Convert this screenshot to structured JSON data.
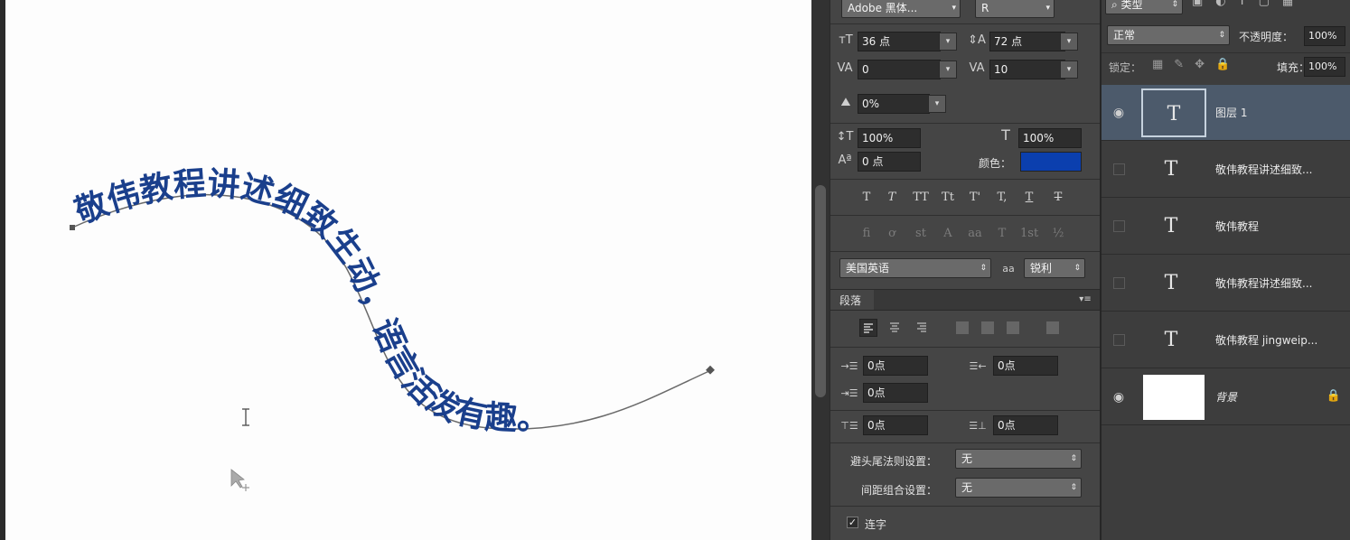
{
  "canvas": {
    "path_text": "敬伟教程讲述细致生动，语言活泼有趣。",
    "text_color": "#1a3f8c"
  },
  "character_panel": {
    "font_family": "Adobe 黑体...",
    "font_style": "R",
    "font_size": "36 点",
    "leading": "72 点",
    "kerning": "0",
    "tracking": "10",
    "tsume": "0%",
    "vertical_scale": "100%",
    "horizontal_scale": "100%",
    "baseline_shift": "0 点",
    "color_label": "颜色：",
    "color_value": "#0b3fae",
    "language": "美国英语",
    "aa_icon": "aa",
    "antialias": "锐利",
    "style_buttons": [
      "T",
      "T",
      "TT",
      "Tt",
      "T'",
      "T,",
      "T",
      "T"
    ],
    "opentype_buttons": [
      "fi",
      "ơ",
      "st",
      "A",
      "aa",
      "T",
      "1st",
      "½"
    ]
  },
  "paragraph_panel": {
    "title": "段落",
    "indent_left": "0点",
    "indent_right": "0点",
    "indent_first": "0点",
    "space_before": "0点",
    "space_after": "0点",
    "kinsoku_label": "避头尾法则设置：",
    "kinsoku_value": "无",
    "mojikumi_label": "间距组合设置：",
    "mojikumi_value": "无",
    "hyphenate_label": "连字"
  },
  "layers_panel": {
    "kind_filter": "类型",
    "blend_mode": "正常",
    "opacity_label": "不透明度：",
    "opacity_value": "100%",
    "lock_label": "锁定：",
    "fill_label": "填充：",
    "fill_value": "100%",
    "layers": [
      {
        "name": "图层 1",
        "type": "text",
        "visible": true,
        "selected": true
      },
      {
        "name": "敬伟教程讲述细致...",
        "type": "text",
        "visible": false,
        "selected": false
      },
      {
        "name": "敬伟教程",
        "type": "text",
        "visible": false,
        "selected": false
      },
      {
        "name": "敬伟教程讲述细致...",
        "type": "text",
        "visible": false,
        "selected": false
      },
      {
        "name": "敬伟教程 jingweip...",
        "type": "text",
        "visible": false,
        "selected": false
      },
      {
        "name": "背景",
        "type": "background",
        "visible": true,
        "selected": false,
        "locked": true
      }
    ]
  }
}
